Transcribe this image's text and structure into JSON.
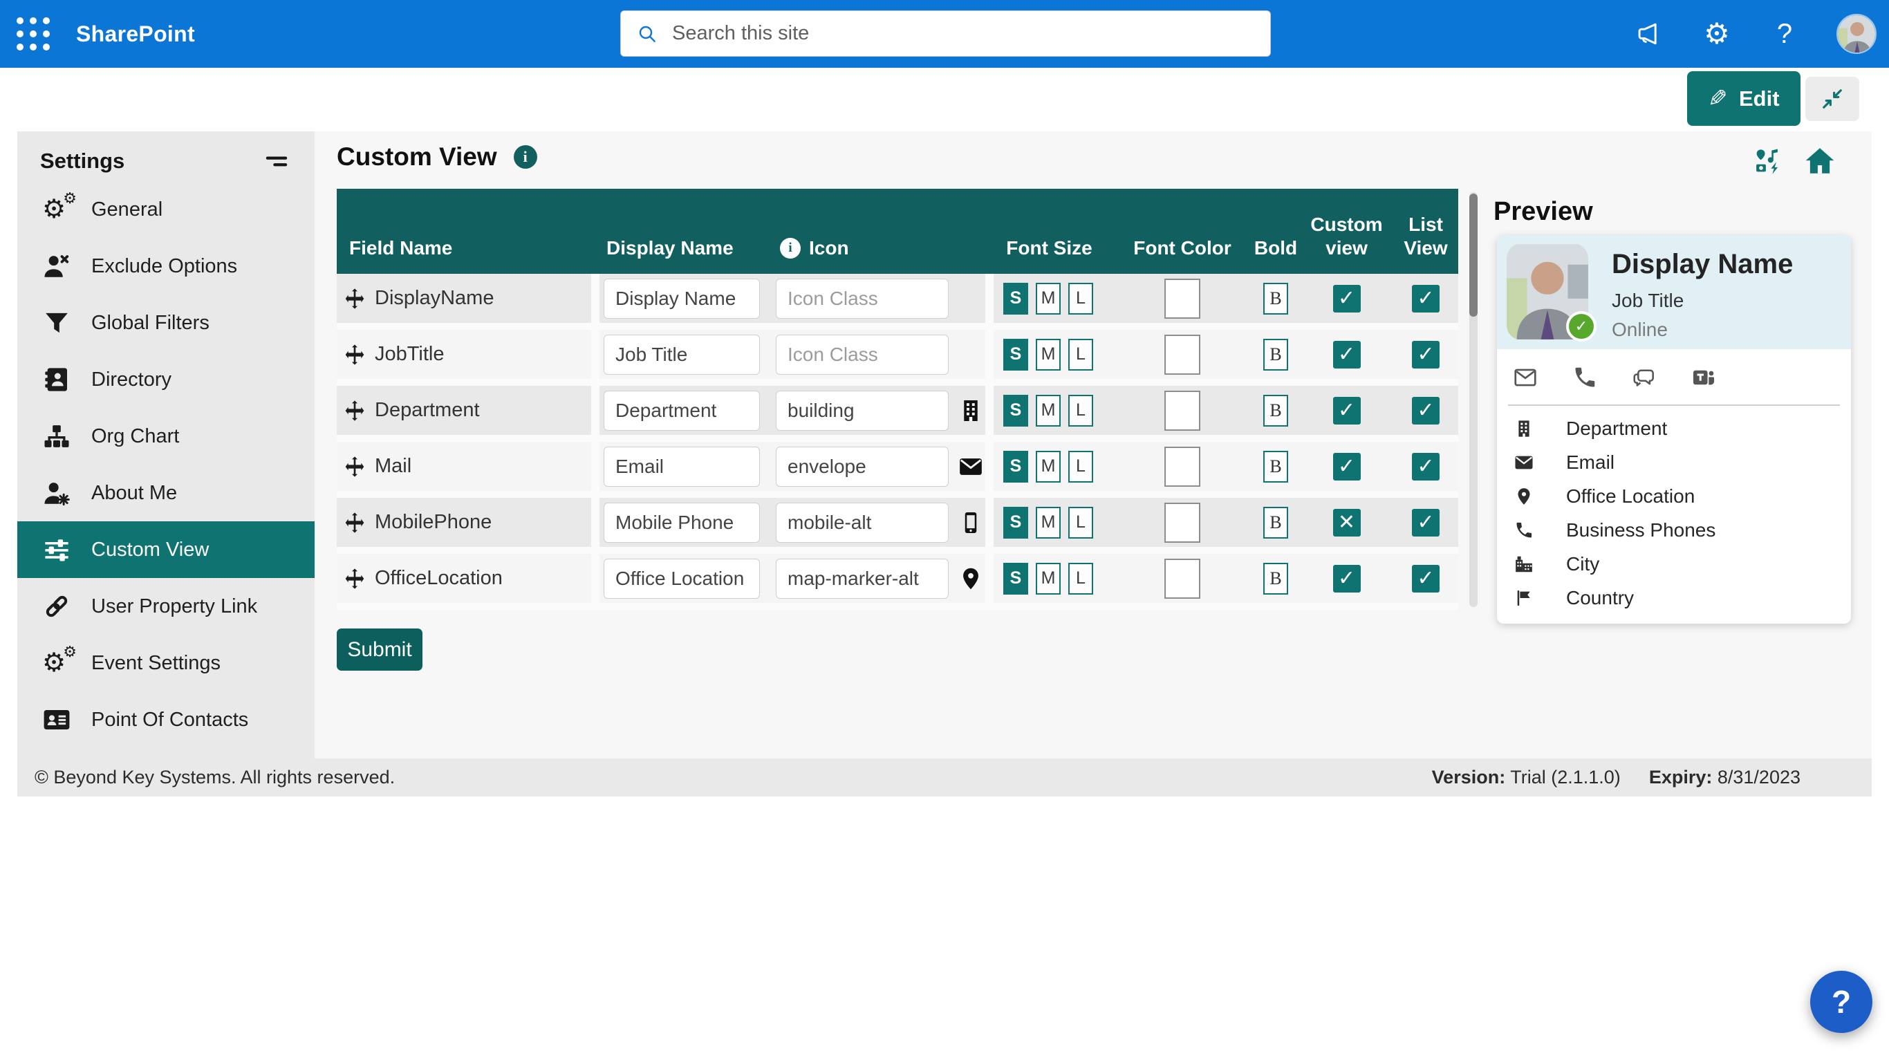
{
  "colors": {
    "brand_blue": "#0b76d6",
    "teal_dark": "#11605f",
    "teal": "#0e7371",
    "submit_teal": "#0d5f5e",
    "fab_blue": "#1c5dc8",
    "presence_green": "#57a82c",
    "sidebar_bg": "#e9e9e9",
    "content_bg": "#f7f7f7"
  },
  "topbar": {
    "app_name": "SharePoint",
    "search_placeholder": "Search this site",
    "icons": [
      "waffle-icon",
      "megaphone-icon",
      "settings-gear-icon",
      "help-icon",
      "user-avatar"
    ]
  },
  "toolbar": {
    "edit_label": "Edit",
    "icons": [
      "pencil-icon",
      "collapse-icon"
    ]
  },
  "sidebar": {
    "title": "Settings",
    "items": [
      {
        "icon": "gears-icon",
        "label": "General",
        "selected": false
      },
      {
        "icon": "user-x-icon",
        "label": "Exclude Options",
        "selected": false
      },
      {
        "icon": "filter-icon",
        "label": "Global Filters",
        "selected": false
      },
      {
        "icon": "address-book-icon",
        "label": "Directory",
        "selected": false
      },
      {
        "icon": "org-chart-icon",
        "label": "Org Chart",
        "selected": false
      },
      {
        "icon": "user-gear-icon",
        "label": "About Me",
        "selected": false
      },
      {
        "icon": "sliders-icon",
        "label": "Custom View",
        "selected": true
      },
      {
        "icon": "link-icon",
        "label": "User Property Link",
        "selected": false
      },
      {
        "icon": "gears-icon",
        "label": "Event Settings",
        "selected": false
      },
      {
        "icon": "id-card-icon",
        "label": "Point Of Contacts",
        "selected": false
      }
    ]
  },
  "page": {
    "title": "Custom View",
    "header_icons": [
      "icon-set-icon",
      "home-icon"
    ]
  },
  "table": {
    "columns": [
      "Field Name",
      "Display Name",
      "Icon",
      "Font Size",
      "Font Color",
      "Bold",
      "Custom view",
      "List View"
    ],
    "info_glyph": "i",
    "sizes": [
      "S",
      "M",
      "L"
    ],
    "selected_size": "S",
    "bold_label": "B",
    "font_color": "#000000",
    "icon_placeholder": "Icon Class",
    "submit_label": "Submit",
    "rows": [
      {
        "field": "DisplayName",
        "display_name": "Display Name",
        "icon_class": "",
        "icon": "",
        "custom_view": "✓",
        "list_view": "✓"
      },
      {
        "field": "JobTitle",
        "display_name": "Job Title",
        "icon_class": "",
        "icon": "",
        "custom_view": "✓",
        "list_view": "✓"
      },
      {
        "field": "Department",
        "display_name": "Department",
        "icon_class": "building",
        "icon": "building-icon",
        "custom_view": "✓",
        "list_view": "✓"
      },
      {
        "field": "Mail",
        "display_name": "Email",
        "icon_class": "envelope",
        "icon": "envelope-icon",
        "custom_view": "✓",
        "list_view": "✓"
      },
      {
        "field": "MobilePhone",
        "display_name": "Mobile Phone",
        "icon_class": "mobile-alt",
        "icon": "mobile-icon",
        "custom_view": "✕",
        "list_view": "✓"
      },
      {
        "field": "OfficeLocation",
        "display_name": "Office Location",
        "icon_class": "map-marker-alt",
        "icon": "map-marker-icon",
        "custom_view": "✓",
        "list_view": "✓"
      }
    ]
  },
  "preview": {
    "title": "Preview",
    "card": {
      "display_name": "Display Name",
      "job_title": "Job Title",
      "presence": "Online"
    },
    "actions": [
      "mail-icon",
      "phone-icon",
      "chat-icon",
      "teams-icon"
    ],
    "fields": [
      {
        "icon": "building-icon",
        "label": "Department"
      },
      {
        "icon": "envelope-icon",
        "label": "Email"
      },
      {
        "icon": "map-marker-icon",
        "label": "Office Location"
      },
      {
        "icon": "phone-icon",
        "label": "Business Phones"
      },
      {
        "icon": "city-icon",
        "label": "City"
      },
      {
        "icon": "flag-icon",
        "label": "Country"
      }
    ]
  },
  "footer": {
    "copyright": "© Beyond Key Systems. All rights reserved.",
    "version_label": "Version:",
    "version": "Trial (2.1.1.0)",
    "expiry_label": "Expiry:",
    "expiry": "8/31/2023"
  },
  "fab": {
    "label": "?"
  }
}
